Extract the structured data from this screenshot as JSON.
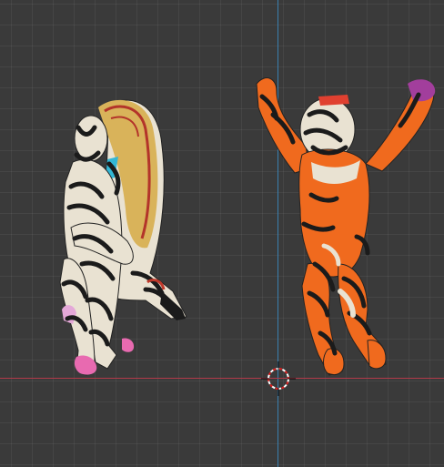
{
  "viewport": {
    "background": "#3a3a3a",
    "grid_color": "#4a4a4a",
    "axis_x_color": "#b33a4a",
    "axis_y_color": "#3a7fb0"
  },
  "objects": [
    {
      "name": "left-dancer-figure",
      "body_color": "#e9e2d2",
      "stripe_color": "#1b1b1b",
      "accent": "#d0b048"
    },
    {
      "name": "right-dancer-figure",
      "body_color": "#f06a1e",
      "stripe_color": "#1b1b1b",
      "accent": "#f0eadf"
    }
  ],
  "cursor": {
    "icon": "3d-cursor-icon",
    "ring_color": "#e02020"
  }
}
